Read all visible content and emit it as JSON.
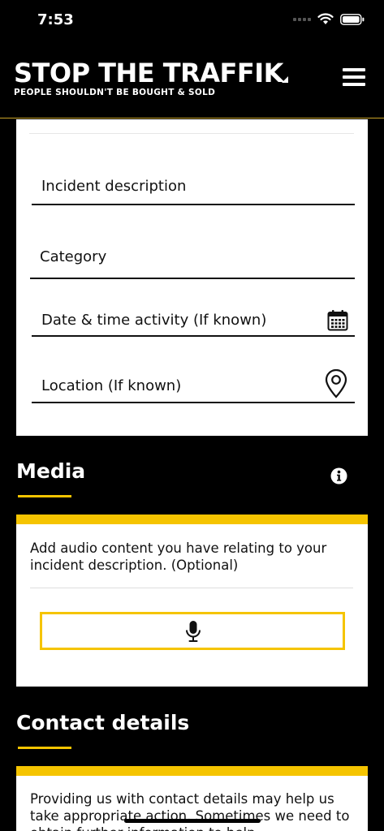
{
  "status_bar": {
    "time": "7:53",
    "icons": [
      "signal-dots-icon",
      "wifi-icon",
      "battery-icon"
    ]
  },
  "header": {
    "brand_title": "STOP THE TRAFFIK",
    "brand_tagline": "PEOPLE SHOULDN'T BE BOUGHT & SOLD",
    "menu_icon": "hamburger-menu-icon"
  },
  "form": {
    "fields": [
      {
        "label": "Incident description"
      },
      {
        "label": "Category"
      },
      {
        "label": "Date & time activity (If known)",
        "icon": "calendar-icon"
      },
      {
        "label": "Location (If known)",
        "icon": "location-pin-icon"
      }
    ]
  },
  "media": {
    "title": "Media",
    "info_icon": "info-icon",
    "description": "Add audio content you have relating to your incident description. (Optional)",
    "record_icon": "microphone-icon"
  },
  "contact": {
    "title": "Contact details",
    "description": "Providing us with contact details  may help us take appropriate action. Sometimes we need to obtain further information to help"
  },
  "colors": {
    "background": "#000000",
    "accent": "#f5c400",
    "card": "#ffffff",
    "header_rule": "#c9a227"
  }
}
